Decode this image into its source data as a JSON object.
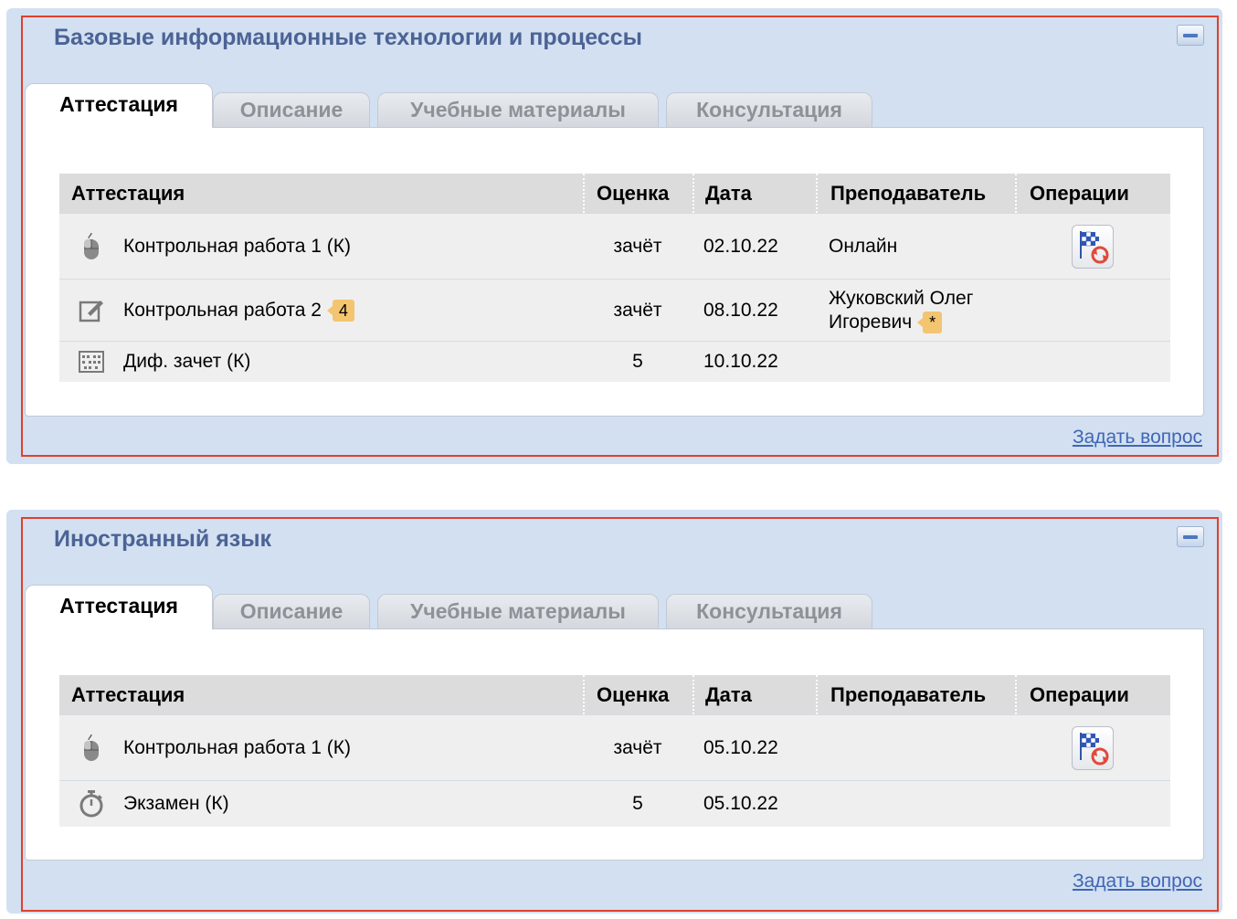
{
  "tabs": [
    "Аттестация",
    "Описание",
    "Учебные материалы",
    "Консультация"
  ],
  "columns": {
    "name": "Аттестация",
    "grade": "Оценка",
    "date": "Дата",
    "teacher": "Преподаватель",
    "ops": "Операции"
  },
  "ask_link": "Задать вопрос",
  "colors": {
    "panel_bg": "#d3e0f1",
    "title": "#4b6395",
    "highlight": "#e0402d",
    "badge": "#f3c570",
    "link": "#3f66b6"
  },
  "panels": [
    {
      "title": "Базовые информационные технологии и процессы",
      "rows": [
        {
          "icon": "mouse-icon",
          "name": "Контрольная работа 1 (К)",
          "badge": "",
          "grade": "зачёт",
          "date": "02.10.22",
          "teacher": "Онлайн",
          "teacher_badge": "",
          "has_op": true
        },
        {
          "icon": "edit-icon",
          "name": "Контрольная работа 2",
          "badge": "4",
          "grade": "зачёт",
          "date": "08.10.22",
          "teacher": "Жуковский Олег Игоревич",
          "teacher_badge": "*",
          "has_op": false
        },
        {
          "icon": "abacus-icon",
          "name": "Диф. зачет (К)",
          "badge": "",
          "grade": "5",
          "date": "10.10.22",
          "teacher": "",
          "teacher_badge": "",
          "has_op": false
        }
      ]
    },
    {
      "title": "Иностранный язык",
      "rows": [
        {
          "icon": "mouse-icon",
          "name": "Контрольная работа 1 (К)",
          "badge": "",
          "grade": "зачёт",
          "date": "05.10.22",
          "teacher": "",
          "teacher_badge": "",
          "has_op": true
        },
        {
          "icon": "stopwatch-icon",
          "name": "Экзамен (К)",
          "badge": "",
          "grade": "5",
          "date": "05.10.22",
          "teacher": "",
          "teacher_badge": "",
          "has_op": false
        }
      ]
    }
  ]
}
